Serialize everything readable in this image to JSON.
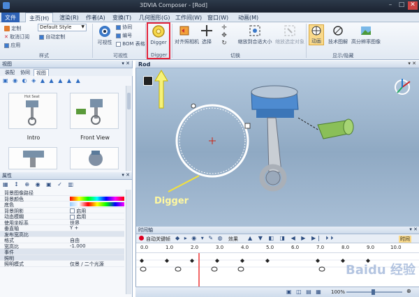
{
  "window": {
    "title": "3DVIA Composer - [Rod]"
  },
  "ribbon_tabs": [
    {
      "label": "文件"
    },
    {
      "label": "主页(H)"
    },
    {
      "label": "渲染(R)"
    },
    {
      "label": "作者(A)"
    },
    {
      "label": "变换(T)"
    },
    {
      "label": "几何图形(G)"
    },
    {
      "label": "工作间(W)"
    },
    {
      "label": "窗口(W)"
    },
    {
      "label": "动画(M)"
    }
  ],
  "ribbon": {
    "style": {
      "custom_label": "定制",
      "style_value": "Default Style",
      "cancel_subscribe": "取消订阅",
      "auto_custom": "自动定制",
      "apply": "应用",
      "group": "样式"
    },
    "visibility": {
      "visibility_label": "可视性",
      "collab": "协同",
      "number": "编号",
      "bom": "BOM 表格",
      "group": "可视性"
    },
    "digger": {
      "label": "Digger",
      "group": "Digger"
    },
    "switch": {
      "align_camera": "对齐照相机",
      "select": "选择",
      "zoom_fit": "缩放到合适大小",
      "zoom_selected": "缩放选定对象",
      "group": "切换"
    },
    "show_hide": {
      "animation": "动画",
      "tech_illustration": "技术图解",
      "hq_image": "高分辨率图像",
      "group": "显示/隐藏"
    }
  },
  "view_panel": {
    "header": "视图",
    "tabs": [
      {
        "label": "装配"
      },
      {
        "label": "协同"
      },
      {
        "label": "视图"
      }
    ],
    "thumbnails": [
      {
        "label": "Intro",
        "thumb_title": "Hot Seat"
      },
      {
        "label": "Front View"
      }
    ]
  },
  "properties_panel": {
    "header": "属性",
    "rows": [
      {
        "key": "背景图像路径",
        "value": "",
        "category": false
      },
      {
        "key": "背景颜色",
        "value": "",
        "category": false
      },
      {
        "key": "底色",
        "value": "",
        "category": false
      },
      {
        "key": "背景阴影",
        "value": "启用",
        "category": false
      },
      {
        "key": "动态模糊",
        "value": "启用",
        "category": false
      },
      {
        "key": "使用坐标系",
        "value": "世界",
        "category": false
      },
      {
        "key": "垂直轴",
        "value": "Y +",
        "category": false
      },
      {
        "key": "发布宽高比",
        "value": "",
        "category": true
      },
      {
        "key": "格式",
        "value": "自由",
        "category": false
      },
      {
        "key": "宽高比",
        "value": "-1.000",
        "category": false
      },
      {
        "key": "事件",
        "value": "",
        "category": true
      },
      {
        "key": "照明",
        "value": "",
        "category": true
      },
      {
        "key": "照明模式",
        "value": "仅景 / 二个光源",
        "category": false
      }
    ]
  },
  "document": {
    "tab": "Rod"
  },
  "annotation": {
    "label": "Digger"
  },
  "timeline": {
    "header": "时间轴",
    "auto_key": "自动关键帧",
    "effects": "效果",
    "time_label": "时间",
    "ticks": [
      "0.0",
      "1.0",
      "2.0",
      "3.0",
      "4.0",
      "5.0",
      "6.0",
      "7.0",
      "8.0",
      "9.0",
      "10.0"
    ]
  },
  "status": {
    "zoom": "100%"
  },
  "watermark": "Baidu 经验"
}
